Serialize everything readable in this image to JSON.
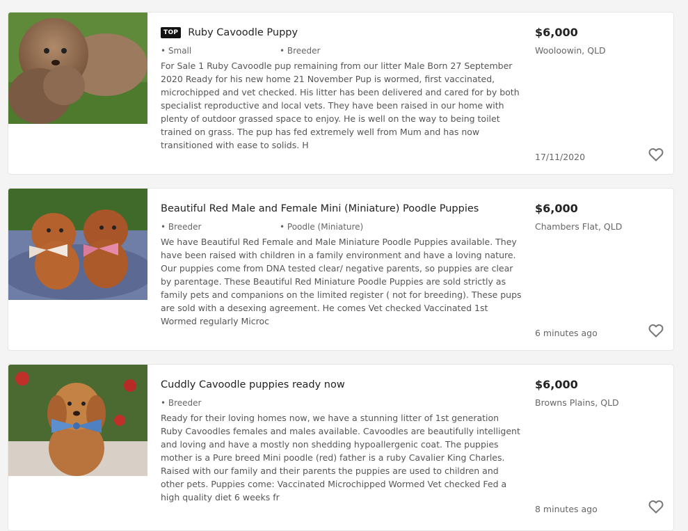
{
  "listings": [
    {
      "badge": "TOP",
      "title": "Ruby Cavoodle Puppy",
      "attributes": [
        "• Small",
        "• Breeder"
      ],
      "description": "For Sale 1 Ruby Cavoodle pup remaining from our litter Male Born 27 September 2020 Ready for his new home 21 November Pup is wormed, first vaccinated, microchipped and vet checked. His litter has been delivered and cared for by both specialist reproductive and local vets. They have been raised in our home with plenty of outdoor grassed space to enjoy. He is well on the way to being toilet trained on grass. The pup has fed extremely well from Mum and has now transitioned with ease to solids. H",
      "price": "$6,000",
      "location": "Wooloowin, QLD",
      "date": "17/11/2020",
      "image_icon": "puppy-photo-brown-cavoodle-on-grass"
    },
    {
      "badge": "",
      "title": "Beautiful Red Male and Female Mini (Miniature) Poodle Puppies",
      "attributes": [
        "• Breeder",
        "• Poodle (Miniature)"
      ],
      "description": "We have Beautiful Red Female and Male Miniature Poodle Puppies available. They have been raised with children in a family environment and have a loving nature. Our puppies come from DNA tested clear/ negative parents, so puppies are clear by parentage. These Beautiful Red Miniature Poodle Puppies are sold strictly as family pets and companions on the limited register ( not for breeding). These pups are sold with a desexing agreement. He comes Vet checked Vaccinated 1st Wormed regularly Microc",
      "price": "$6,000",
      "location": "Chambers Flat, QLD",
      "date": "6 minutes ago",
      "image_icon": "puppy-photo-two-red-poodles-with-bows"
    },
    {
      "badge": "",
      "title": "Cuddly Cavoodle puppies ready now",
      "attributes": [
        "• Breeder"
      ],
      "description": "Ready for their loving homes now, we have a stunning litter of 1st generation Ruby Cavoodles females and males available. Cavoodles are beautifully intelligent and loving and have a mostly non shedding hypoallergenic coat. The puppies mother is a Pure breed Mini poodle (red) father is a ruby Cavalier King Charles. Raised with our family and their parents the puppies are used to children and other pets. Puppies come: Vaccinated Microchipped Wormed Vet checked Fed a high quality diet 6 weeks fr",
      "price": "$6,000",
      "location": "Browns Plains, QLD",
      "date": "8 minutes ago",
      "image_icon": "puppy-photo-cavoodle-with-blue-bow"
    }
  ],
  "colors": {
    "background": "#f4f4f4",
    "card": "#ffffff",
    "badge": "#111111",
    "price": "#222222",
    "muted": "#666666"
  },
  "icons": {
    "favourite": "heart-outline-icon"
  }
}
